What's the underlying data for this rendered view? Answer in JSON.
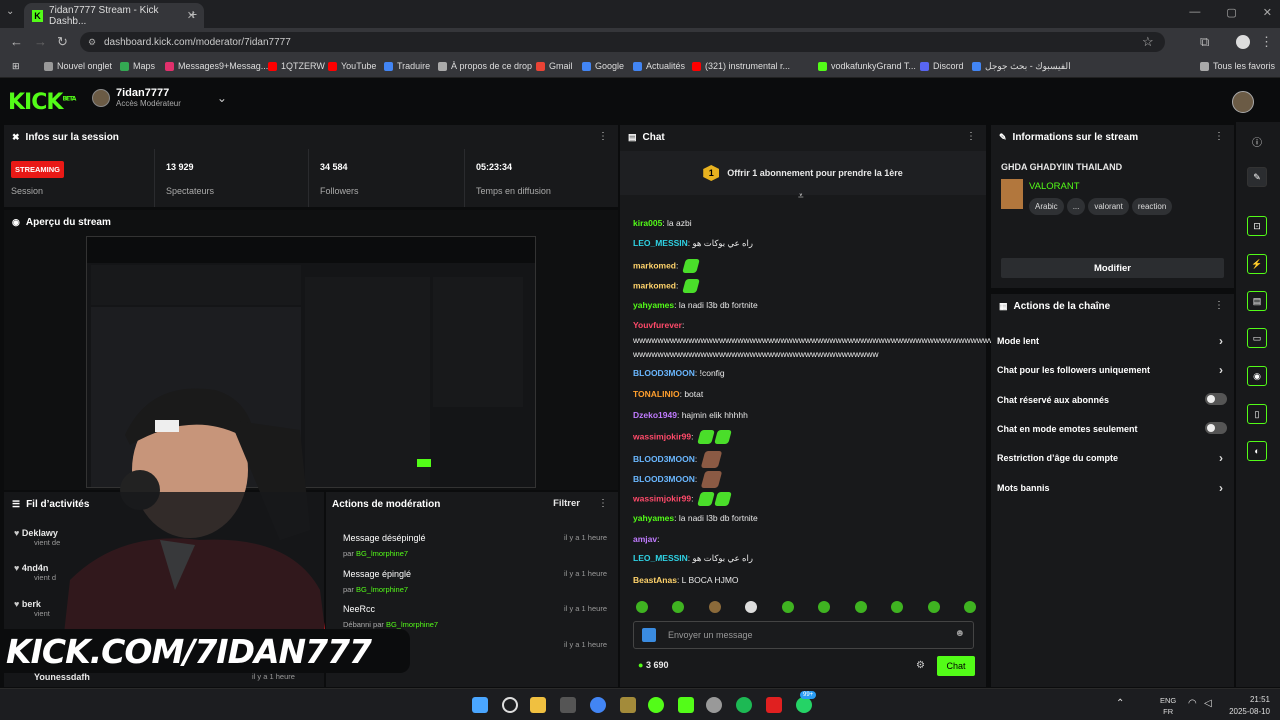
{
  "browser": {
    "tab_title": "7idan7777 Stream - Kick Dashb...",
    "url": "dashboard.kick.com/moderator/7idan7777",
    "bookmarks": [
      "Nouvel onglet",
      "Maps",
      "Messages9+Messag...",
      "1QTZERW",
      "YouTube",
      "Traduire",
      "À propos de ce drop",
      "Gmail",
      "Google",
      "Actualités",
      "(321) instrumental r...",
      "vodkafunkyGrand T...",
      "Discord",
      "الفيسبوك - بحث جوجل"
    ],
    "all_favorites": "Tous les favoris"
  },
  "header": {
    "logo": "KICK",
    "logo_sup": "BETA",
    "channel_name": "7idan7777",
    "role": "Accès Modérateur"
  },
  "session": {
    "title": "Infos sur la session",
    "status_badge": "STREAMING",
    "status_label": "Session",
    "viewers_value": "13 929",
    "viewers_label": "Spectateurs",
    "followers_value": "34 584",
    "followers_label": "Followers",
    "uptime_value": "05:23:34",
    "uptime_label": "Temps en diffusion"
  },
  "preview": {
    "title": "Aperçu du stream"
  },
  "activity": {
    "title": "Fil d’activités",
    "items": [
      {
        "name": "Deklawy",
        "sub": "vient de"
      },
      {
        "name": "4nd4n",
        "sub": "vient d"
      },
      {
        "name": "berk",
        "sub": "vient"
      },
      {
        "name": "Younessdafh",
        "sub": ""
      }
    ]
  },
  "banner": {
    "text": "KICK.COM/7IDAN777"
  },
  "moderation": {
    "title": "Actions de modération",
    "filter": "Filtrer",
    "items": [
      {
        "title": "Message désépinglé",
        "by": "par",
        "user": "BG_lmorphine7",
        "time": "il y a 1 heure"
      },
      {
        "title": "Message épinglé",
        "by": "par",
        "user": "BG_lmorphine7",
        "time": "il y a 1 heure"
      },
      {
        "title": "NeeRcc",
        "by": "Débanni par",
        "user": "BG_lmorphine7",
        "time": "il y a 1 heure"
      },
      {
        "title": "",
        "by": "",
        "user": "phine7",
        "time": "il y a 1 heure"
      },
      {
        "title": "Message désépinglé",
        "by": "",
        "user": "",
        "time": "il y a 1 heure"
      }
    ],
    "footer_time": "il y a 1 heure"
  },
  "chat": {
    "title": "Chat",
    "promo": "Offrir 1 abonnement pour prendre la 1ère",
    "messages": [
      {
        "user": "kira005",
        "color": "#53fc18",
        "text": "la azbi",
        "emotes": 0
      },
      {
        "user": "LEO_MESSIN",
        "color": "#2fd2e4",
        "text": "راه عي بوكات هو",
        "emotes": 0
      },
      {
        "user": "markomed",
        "color": "#ffd36b",
        "text": "",
        "emotes": 1
      },
      {
        "user": "markomed",
        "color": "#ffd36b",
        "text": "",
        "emotes": 1
      },
      {
        "user": "yahyames",
        "color": "#53fc18",
        "text": "la nadi l3b db fortnite",
        "emotes": 0
      },
      {
        "user": "Youvfurever",
        "color": "#ff4a6a",
        "text": "",
        "emotes": 0
      },
      {
        "user": "",
        "color": "#e8e8e8",
        "text": "wwwwwwwwwwwwwwwwwwwwwwwwwwwwwwwwwwwwwwwwwwwwwwwwwwwwwwwwwwwwww",
        "emotes": 0
      },
      {
        "user": "",
        "color": "#e8e8e8",
        "text": "wwwwwwwwwwwwwwwwwwwwwwwwwwwwwwwwwwwwwwww",
        "emotes": 0
      },
      {
        "user": "BLOOD3MOON",
        "color": "#6ab7ff",
        "text": "!config",
        "emotes": 0
      },
      {
        "user": "TONALINIO",
        "color": "#ff9f2e",
        "text": "botat",
        "emotes": 0
      },
      {
        "user": "Dzeko1949",
        "color": "#c07bff",
        "text": "hajmin elik hhhhh",
        "emotes": 0
      },
      {
        "user": "wassimjokir99",
        "color": "#ff4a6a",
        "text": "",
        "emotes": 2
      },
      {
        "user": "BLOOD3MOON",
        "color": "#6ab7ff",
        "text": "",
        "emotes": 1,
        "face": true
      },
      {
        "user": "BLOOD3MOON",
        "color": "#6ab7ff",
        "text": "",
        "emotes": 1,
        "face": true
      },
      {
        "user": "wassimjokir99",
        "color": "#ff4a6a",
        "text": "",
        "emotes": 2
      },
      {
        "user": "yahyames",
        "color": "#53fc18",
        "text": "la nadi l3b db fortnite",
        "emotes": 0
      },
      {
        "user": "amjav",
        "color": "#c07bff",
        "text": "",
        "emotes": 0
      },
      {
        "user": "LEO_MESSIN",
        "color": "#2fd2e4",
        "text": "راه عي بوكات هو",
        "emotes": 0
      },
      {
        "user": "BeastAnas",
        "color": "#ffd36b",
        "text": "L BOCA HJMO",
        "emotes": 0
      }
    ],
    "placeholder": "Envoyer un message",
    "points": "3 690",
    "send": "Chat"
  },
  "stream_info": {
    "title": "Informations sur le stream",
    "stream_title": "GHDA GHADYIIN THAILAND",
    "category": "VALORANT",
    "tags": [
      "Arabic",
      "...",
      "valorant",
      "reaction"
    ],
    "edit_button": "Modifier"
  },
  "channel_actions": {
    "title": "Actions de la chaîne",
    "items": [
      {
        "label": "Mode lent",
        "type": "chevron"
      },
      {
        "label": "Chat pour les followers uniquement",
        "type": "chevron"
      },
      {
        "label": "Chat réservé aux abonnés",
        "type": "toggle"
      },
      {
        "label": "Chat en mode emotes seulement",
        "type": "toggle"
      },
      {
        "label": "Restriction d’âge du compte",
        "type": "chevron"
      },
      {
        "label": "Mots bannis",
        "type": "chevron"
      }
    ]
  },
  "taskbar": {
    "lang": "ENG",
    "region": "FR",
    "time": "21:51",
    "date": "2025-08-10",
    "badge": "99+"
  },
  "colors": {
    "accent": "#53fc18",
    "live": "#e91916",
    "panel": "#18191b",
    "bg": "#0b0c0d"
  }
}
